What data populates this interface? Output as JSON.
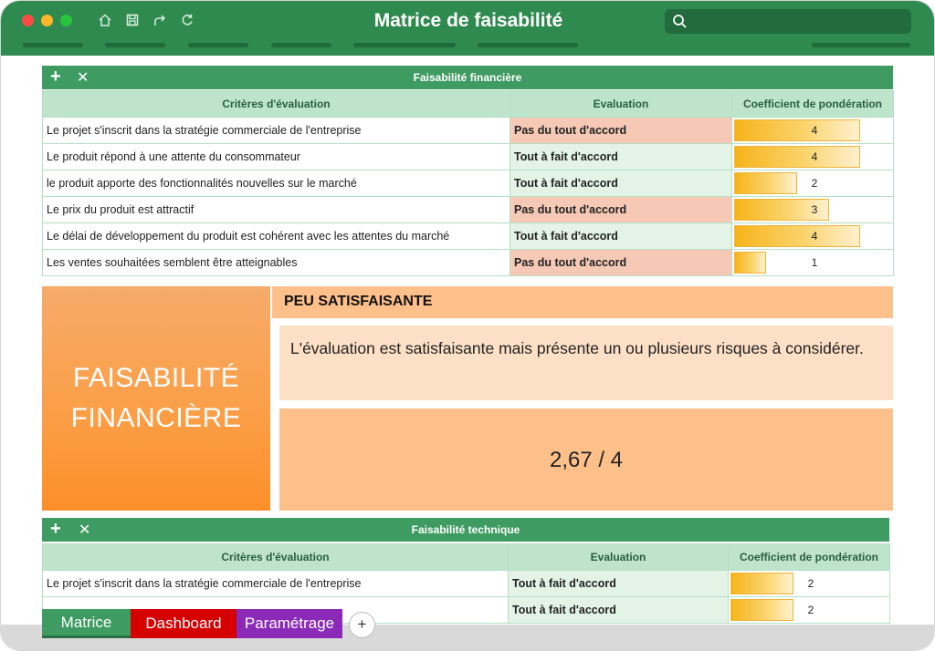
{
  "window": {
    "title": "Matrice de faisabilité"
  },
  "toolbar": {
    "icons": [
      "home-icon",
      "save-icon",
      "share-icon",
      "refresh-icon"
    ],
    "search_icon": "search-icon"
  },
  "colors": {
    "titlebar": "#2f8a4f",
    "header_green": "#3e9b62",
    "bad": "#e8221b",
    "good": "#1fa84b",
    "orange": "#fb9f48"
  },
  "financial": {
    "title": "Faisabilité financière",
    "add_label": "+",
    "close_label": "✕",
    "columns": [
      "Critères d'évaluation",
      "Evaluation",
      "Coefficient de pondération"
    ],
    "rows": [
      {
        "criterion": "Le projet s'inscrit dans la stratégie commerciale de l'entreprise",
        "evaluation": "Pas du tout d'accord",
        "status": "bad",
        "coef": 4
      },
      {
        "criterion": "Le produit répond à une attente du consommateur",
        "evaluation": "Tout à fait d'accord",
        "status": "good",
        "coef": 4
      },
      {
        "criterion": "le produit apporte des fonctionnalités nouvelles sur le marché",
        "evaluation": "Tout à fait d'accord",
        "status": "good",
        "coef": 2
      },
      {
        "criterion": "Le prix du produit est attractif",
        "evaluation": "Pas du tout d'accord",
        "status": "bad",
        "coef": 3
      },
      {
        "criterion": "Le délai de développement du produit est cohérent avec les attentes du marché",
        "evaluation": "Tout à fait d'accord",
        "status": "good",
        "coef": 4
      },
      {
        "criterion": "Les ventes souhaitées semblent être atteignables",
        "evaluation": "Pas du tout d'accord",
        "status": "bad",
        "coef": 1
      }
    ],
    "coef_max": 4
  },
  "result": {
    "label_line1": "FAISABILITÉ",
    "label_line2": "FINANCIÈRE",
    "status": "PEU SATISFAISANTE",
    "description": "L'évaluation est satisfaisante mais présente un ou plusieurs risques à considérer.",
    "score": "2,67 / 4"
  },
  "technical": {
    "title": "Faisabilité technique",
    "add_label": "+",
    "close_label": "✕",
    "columns": [
      "Critères d'évaluation",
      "Evaluation",
      "Coefficient de pondération"
    ],
    "rows": [
      {
        "criterion": "Le projet s'inscrit dans la stratégie commerciale de l'entreprise",
        "evaluation": "Tout à fait d'accord",
        "status": "good",
        "coef": 2
      },
      {
        "criterion": "",
        "evaluation": "Tout à fait d'accord",
        "status": "good",
        "coef": 2
      }
    ],
    "coef_max": 4
  },
  "tabs": {
    "matrice": "Matrice",
    "dashboard": "Dashboard",
    "parametrage": "Paramétrage",
    "add": "+"
  }
}
